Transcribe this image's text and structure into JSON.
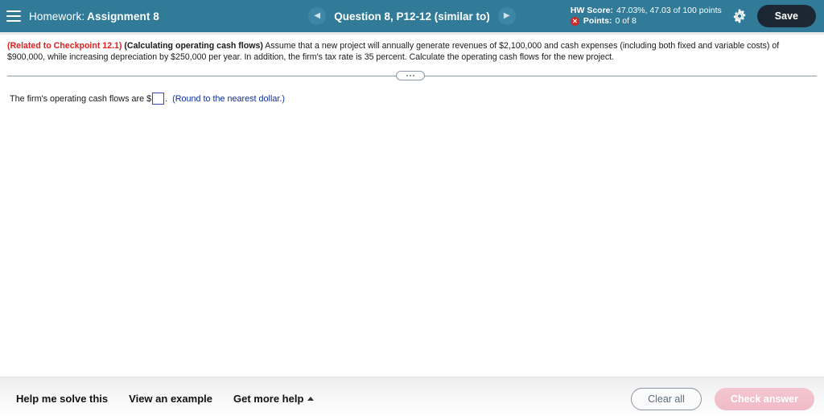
{
  "header": {
    "menu_icon": "hamburger-icon",
    "course_label": "Homework:",
    "assignment_name": "Assignment 8",
    "prev_icon": "chevron-left-icon",
    "next_icon": "chevron-right-icon",
    "question_title": "Question 8, P12-12 (similar to)",
    "hw_score_label": "HW Score:",
    "hw_score_value": "47.03%, 47.03 of 100 points",
    "points_status_icon": "error-circle-icon",
    "points_label": "Points:",
    "points_value": "0 of 8",
    "settings_icon": "gear-icon",
    "save_label": "Save",
    "bg_color": "#317b99",
    "save_bg_color": "#1b2733"
  },
  "question": {
    "checkpoint_ref": "(Related to Checkpoint 12.1)",
    "checkpoint_color": "#e02020",
    "topic": "(Calculating operating cash flows)",
    "body": "Assume that a new project will annually generate revenues of $2,100,000 and cash expenses (including both fixed and variable costs) of $900,000, while increasing depreciation by $250,000 per year.  In addition, the firm's tax rate is 35 percent.  Calculate the operating cash flows for the new project."
  },
  "divider": {
    "handle_icon": "drag-handle-dots-icon"
  },
  "answer": {
    "prompt": "The firm's operating cash flows are",
    "currency_symbol": "$",
    "input_value": "",
    "input_placeholder": "",
    "period": ".",
    "instruction": "(Round to the nearest dollar.)",
    "instruction_color": "#10309a",
    "input_border_color": "#2e4ea8"
  },
  "footer": {
    "help_me_solve_this": "Help me solve this",
    "view_an_example": "View an example",
    "get_more_help": "Get more help",
    "get_more_help_icon": "caret-up-icon",
    "clear_all": "Clear all",
    "check_answer": "Check answer",
    "check_answer_bg": "#f1c0cb"
  }
}
